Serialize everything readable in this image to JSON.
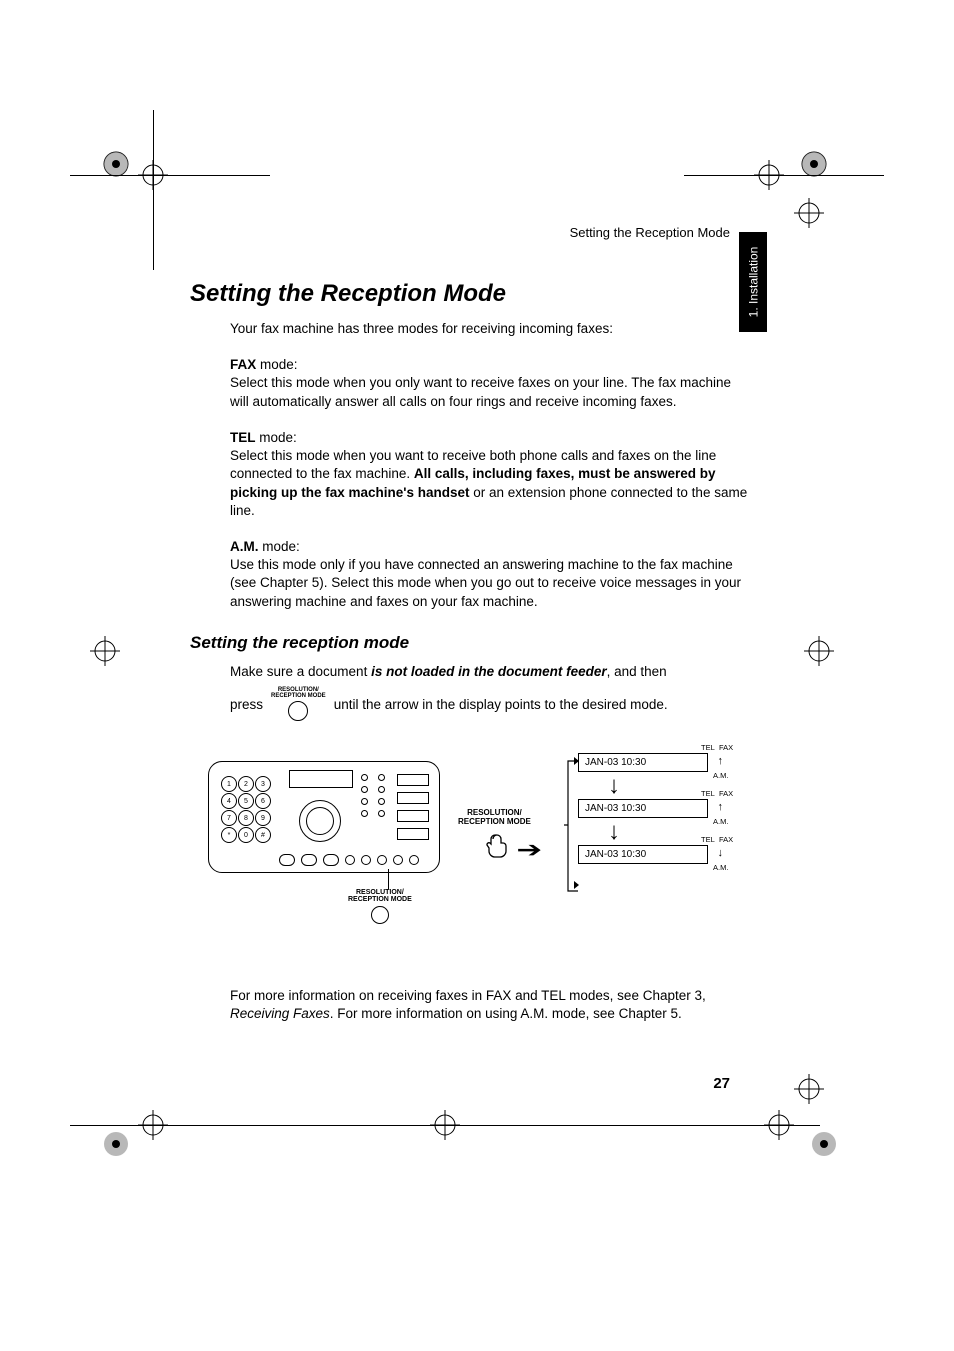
{
  "header": {
    "running_title": "Setting the Reception Mode"
  },
  "sideTab": {
    "label": "1. Installation"
  },
  "title": "Setting the Reception Mode",
  "intro": "Your fax machine has three modes for receiving incoming faxes:",
  "modes": {
    "fax": {
      "label": "FAX",
      "suffix": " mode:",
      "text": "Select this mode when you only want to receive faxes on your line. The fax machine will automatically answer all calls on four rings and receive incoming faxes."
    },
    "tel": {
      "label": "TEL",
      "suffix": " mode:",
      "text_pre": "Select this mode when you want to receive both phone calls and faxes on the line connected to the fax machine. ",
      "bold": "All calls, including faxes, must be answered by picking up the fax machine's handset",
      "text_post": " or an extension phone connected to the same line."
    },
    "am": {
      "label": "A.M.",
      "suffix": " mode:",
      "text": "Use this mode only if you have connected an answering machine to the fax machine (see Chapter 5). Select this mode when you go out to receive voice messages in your answering machine and faxes on your fax machine."
    }
  },
  "subhead": "Setting the reception mode",
  "instruct": {
    "pre": "Make sure a document ",
    "bold_italic": "is not loaded in the document feeder",
    "post": ", and then"
  },
  "press": {
    "pre": "press",
    "button_label1": "RESOLUTION/",
    "button_label2": "RECEPTION MODE",
    "post": "until the arrow in the display points to the desired mode."
  },
  "diagram": {
    "keypad": [
      "1",
      "2",
      "3",
      "4",
      "5",
      "6",
      "7",
      "8",
      "9",
      "*",
      "0",
      "#"
    ],
    "panel_label1": "RESOLUTION/",
    "panel_label2": "RECEPTION MODE",
    "mid_label1": "RESOLUTION/",
    "mid_label2": "RECEPTION MODE",
    "lcd_text": "JAN-03 10:30",
    "tel_label": "TEL",
    "fax_label": "FAX",
    "am_label": "A.M.",
    "arrow_up": "↑",
    "arrow_down": "↓"
  },
  "footer": {
    "pre": "For more information on receiving faxes in FAX and TEL modes, see Chapter 3, ",
    "italic": "Receiving Faxes",
    "post": ". For more information on using A.M. mode, see Chapter 5."
  },
  "pageNumber": "27"
}
